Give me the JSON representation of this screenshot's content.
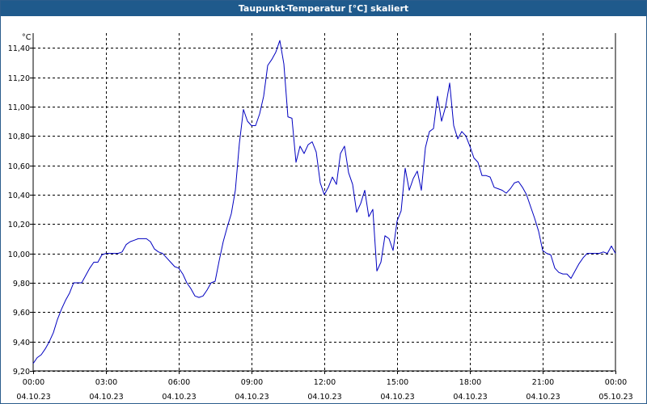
{
  "window": {
    "title": "Taupunkt-Temperatur [°C] skaliert"
  },
  "colors": {
    "title_bar": "#1f5a8c",
    "line": "#0000c0",
    "grid": "#000000",
    "background": "#ffffff"
  },
  "chart_data": {
    "type": "line",
    "title": "Taupunkt-Temperatur [°C] skaliert",
    "unit": "°C",
    "xlabel": "",
    "ylabel": "",
    "xlim": [
      "2023-10-04 00:00",
      "2023-10-05 00:00"
    ],
    "ylim": [
      9.2,
      11.5
    ],
    "grid": true,
    "legend": "none",
    "y_ticks": [
      "9,20",
      "9,40",
      "9,60",
      "9,80",
      "10,00",
      "10,20",
      "10,40",
      "10,60",
      "10,80",
      "11,00",
      "11,20",
      "11,40"
    ],
    "x_ticks": [
      {
        "time": "00:00",
        "date": "04.10.23"
      },
      {
        "time": "03:00",
        "date": "04.10.23"
      },
      {
        "time": "06:00",
        "date": "04.10.23"
      },
      {
        "time": "09:00",
        "date": "04.10.23"
      },
      {
        "time": "12:00",
        "date": "04.10.23"
      },
      {
        "time": "15:00",
        "date": "04.10.23"
      },
      {
        "time": "18:00",
        "date": "04.10.23"
      },
      {
        "time": "21:00",
        "date": "04.10.23"
      },
      {
        "time": "00:00",
        "date": "05.10.23"
      }
    ],
    "series": [
      {
        "x": [
          "2023-10-04 00:00",
          "2023-10-04 00:10",
          "2023-10-04 00:20",
          "2023-10-04 00:30",
          "2023-10-04 00:40",
          "2023-10-04 00:50",
          "2023-10-04 01:00",
          "2023-10-04 01:10",
          "2023-10-04 01:20",
          "2023-10-04 01:30",
          "2023-10-04 01:40",
          "2023-10-04 01:50",
          "2023-10-04 02:00",
          "2023-10-04 02:10",
          "2023-10-04 02:20",
          "2023-10-04 02:30",
          "2023-10-04 02:40",
          "2023-10-04 02:50",
          "2023-10-04 03:00",
          "2023-10-04 03:10",
          "2023-10-04 03:20",
          "2023-10-04 03:30",
          "2023-10-04 03:40",
          "2023-10-04 03:50",
          "2023-10-04 04:00",
          "2023-10-04 04:10",
          "2023-10-04 04:20",
          "2023-10-04 04:30",
          "2023-10-04 04:40",
          "2023-10-04 04:50",
          "2023-10-04 05:00",
          "2023-10-04 05:10",
          "2023-10-04 05:20",
          "2023-10-04 05:30",
          "2023-10-04 05:40",
          "2023-10-04 05:50",
          "2023-10-04 06:00",
          "2023-10-04 06:10",
          "2023-10-04 06:20",
          "2023-10-04 06:30",
          "2023-10-04 06:40",
          "2023-10-04 06:50",
          "2023-10-04 07:00",
          "2023-10-04 07:10",
          "2023-10-04 07:20",
          "2023-10-04 07:30",
          "2023-10-04 07:40",
          "2023-10-04 07:50",
          "2023-10-04 08:00",
          "2023-10-04 08:10",
          "2023-10-04 08:20",
          "2023-10-04 08:30",
          "2023-10-04 08:40",
          "2023-10-04 08:50",
          "2023-10-04 09:00",
          "2023-10-04 09:10",
          "2023-10-04 09:20",
          "2023-10-04 09:30",
          "2023-10-04 09:40",
          "2023-10-04 09:50",
          "2023-10-04 10:00",
          "2023-10-04 10:10",
          "2023-10-04 10:20",
          "2023-10-04 10:30",
          "2023-10-04 10:40",
          "2023-10-04 10:50",
          "2023-10-04 11:00",
          "2023-10-04 11:10",
          "2023-10-04 11:20",
          "2023-10-04 11:30",
          "2023-10-04 11:40",
          "2023-10-04 11:50",
          "2023-10-04 12:00",
          "2023-10-04 12:10",
          "2023-10-04 12:20",
          "2023-10-04 12:30",
          "2023-10-04 12:40",
          "2023-10-04 12:50",
          "2023-10-04 13:00",
          "2023-10-04 13:10",
          "2023-10-04 13:20",
          "2023-10-04 13:30",
          "2023-10-04 13:40",
          "2023-10-04 13:50",
          "2023-10-04 14:00",
          "2023-10-04 14:10",
          "2023-10-04 14:20",
          "2023-10-04 14:30",
          "2023-10-04 14:40",
          "2023-10-04 14:50",
          "2023-10-04 15:00",
          "2023-10-04 15:10",
          "2023-10-04 15:20",
          "2023-10-04 15:30",
          "2023-10-04 15:40",
          "2023-10-04 15:50",
          "2023-10-04 16:00",
          "2023-10-04 16:10",
          "2023-10-04 16:20",
          "2023-10-04 16:30",
          "2023-10-04 16:40",
          "2023-10-04 16:50",
          "2023-10-04 17:00",
          "2023-10-04 17:10",
          "2023-10-04 17:20",
          "2023-10-04 17:30",
          "2023-10-04 17:40",
          "2023-10-04 17:50",
          "2023-10-04 18:00",
          "2023-10-04 18:10",
          "2023-10-04 18:20",
          "2023-10-04 18:30",
          "2023-10-04 18:40",
          "2023-10-04 18:50",
          "2023-10-04 19:00",
          "2023-10-04 19:10",
          "2023-10-04 19:20",
          "2023-10-04 19:30",
          "2023-10-04 19:40",
          "2023-10-04 19:50",
          "2023-10-04 20:00",
          "2023-10-04 20:10",
          "2023-10-04 20:20",
          "2023-10-04 20:30",
          "2023-10-04 20:40",
          "2023-10-04 20:50",
          "2023-10-04 21:00",
          "2023-10-04 21:10",
          "2023-10-04 21:20",
          "2023-10-04 21:30",
          "2023-10-04 21:40",
          "2023-10-04 21:50",
          "2023-10-04 22:00",
          "2023-10-04 22:10",
          "2023-10-04 22:20",
          "2023-10-04 22:30",
          "2023-10-04 22:40",
          "2023-10-04 22:50",
          "2023-10-04 23:00",
          "2023-10-04 23:10",
          "2023-10-04 23:20",
          "2023-10-04 23:30",
          "2023-10-04 23:40",
          "2023-10-04 23:50",
          "2023-10-05 00:00"
        ],
        "y": [
          9.25,
          9.29,
          9.31,
          9.35,
          9.4,
          9.46,
          9.55,
          9.62,
          9.68,
          9.73,
          9.8,
          9.8,
          9.8,
          9.85,
          9.9,
          9.94,
          9.94,
          9.99,
          10.0,
          10.0,
          10.0,
          10.0,
          10.01,
          10.06,
          10.08,
          10.09,
          10.1,
          10.1,
          10.1,
          10.08,
          10.03,
          10.01,
          10.0,
          9.97,
          9.94,
          9.91,
          9.9,
          9.86,
          9.8,
          9.76,
          9.71,
          9.7,
          9.71,
          9.75,
          9.8,
          9.81,
          9.95,
          10.08,
          10.18,
          10.27,
          10.43,
          10.75,
          10.98,
          10.9,
          10.87,
          10.87,
          10.95,
          11.07,
          11.28,
          11.32,
          11.37,
          11.45,
          11.29,
          10.93,
          10.92,
          10.62,
          10.73,
          10.68,
          10.74,
          10.76,
          10.69,
          10.48,
          10.4,
          10.45,
          10.52,
          10.47,
          10.68,
          10.73,
          10.55,
          10.47,
          10.28,
          10.34,
          10.43,
          10.25,
          10.3,
          9.88,
          9.94,
          10.12,
          10.1,
          10.02,
          10.22,
          10.29,
          10.58,
          10.43,
          10.51,
          10.56,
          10.43,
          10.72,
          10.83,
          10.85,
          11.07,
          10.9,
          11.0,
          11.16,
          10.87,
          10.78,
          10.83,
          10.8,
          10.73,
          10.65,
          10.62,
          10.53,
          10.53,
          10.52,
          10.45,
          10.44,
          10.43,
          10.41,
          10.44,
          10.48,
          10.49,
          10.45,
          10.4,
          10.32,
          10.24,
          10.15,
          10.02,
          10.0,
          9.99,
          9.9,
          9.87,
          9.86,
          9.86,
          9.83,
          9.88,
          9.93,
          9.97,
          10.0,
          10.0,
          10.0,
          10.0,
          10.01,
          10.0,
          10.05,
          10.0
        ]
      }
    ]
  }
}
